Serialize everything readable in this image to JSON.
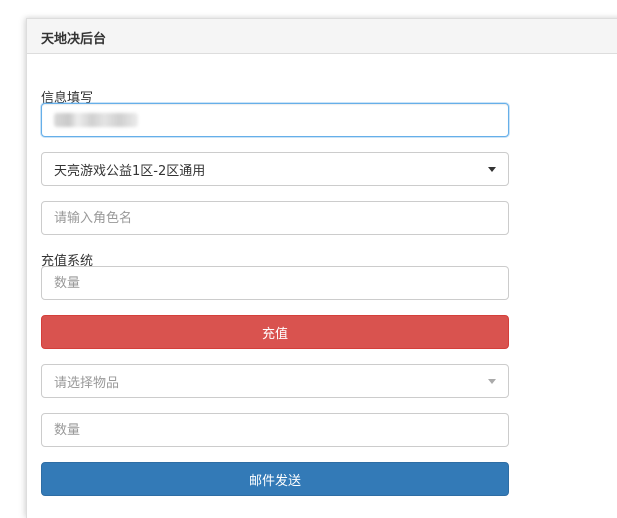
{
  "header": {
    "title": "天地决后台"
  },
  "info_section": {
    "label": "信息填写",
    "server_select": {
      "selected": "天亮游戏公益1区-2区通用"
    },
    "role_input": {
      "placeholder": "请输入角色名"
    }
  },
  "recharge_section": {
    "label": "充值系统",
    "amount_input": {
      "placeholder": "数量"
    },
    "recharge_button": {
      "label": "充值"
    },
    "item_select": {
      "selected": "请选择物品"
    },
    "quantity_input": {
      "placeholder": "数量"
    },
    "send_mail_button": {
      "label": "邮件发送"
    }
  },
  "colors": {
    "danger": "#d9534f",
    "primary": "#337ab7",
    "focus_border": "#66afe9"
  }
}
